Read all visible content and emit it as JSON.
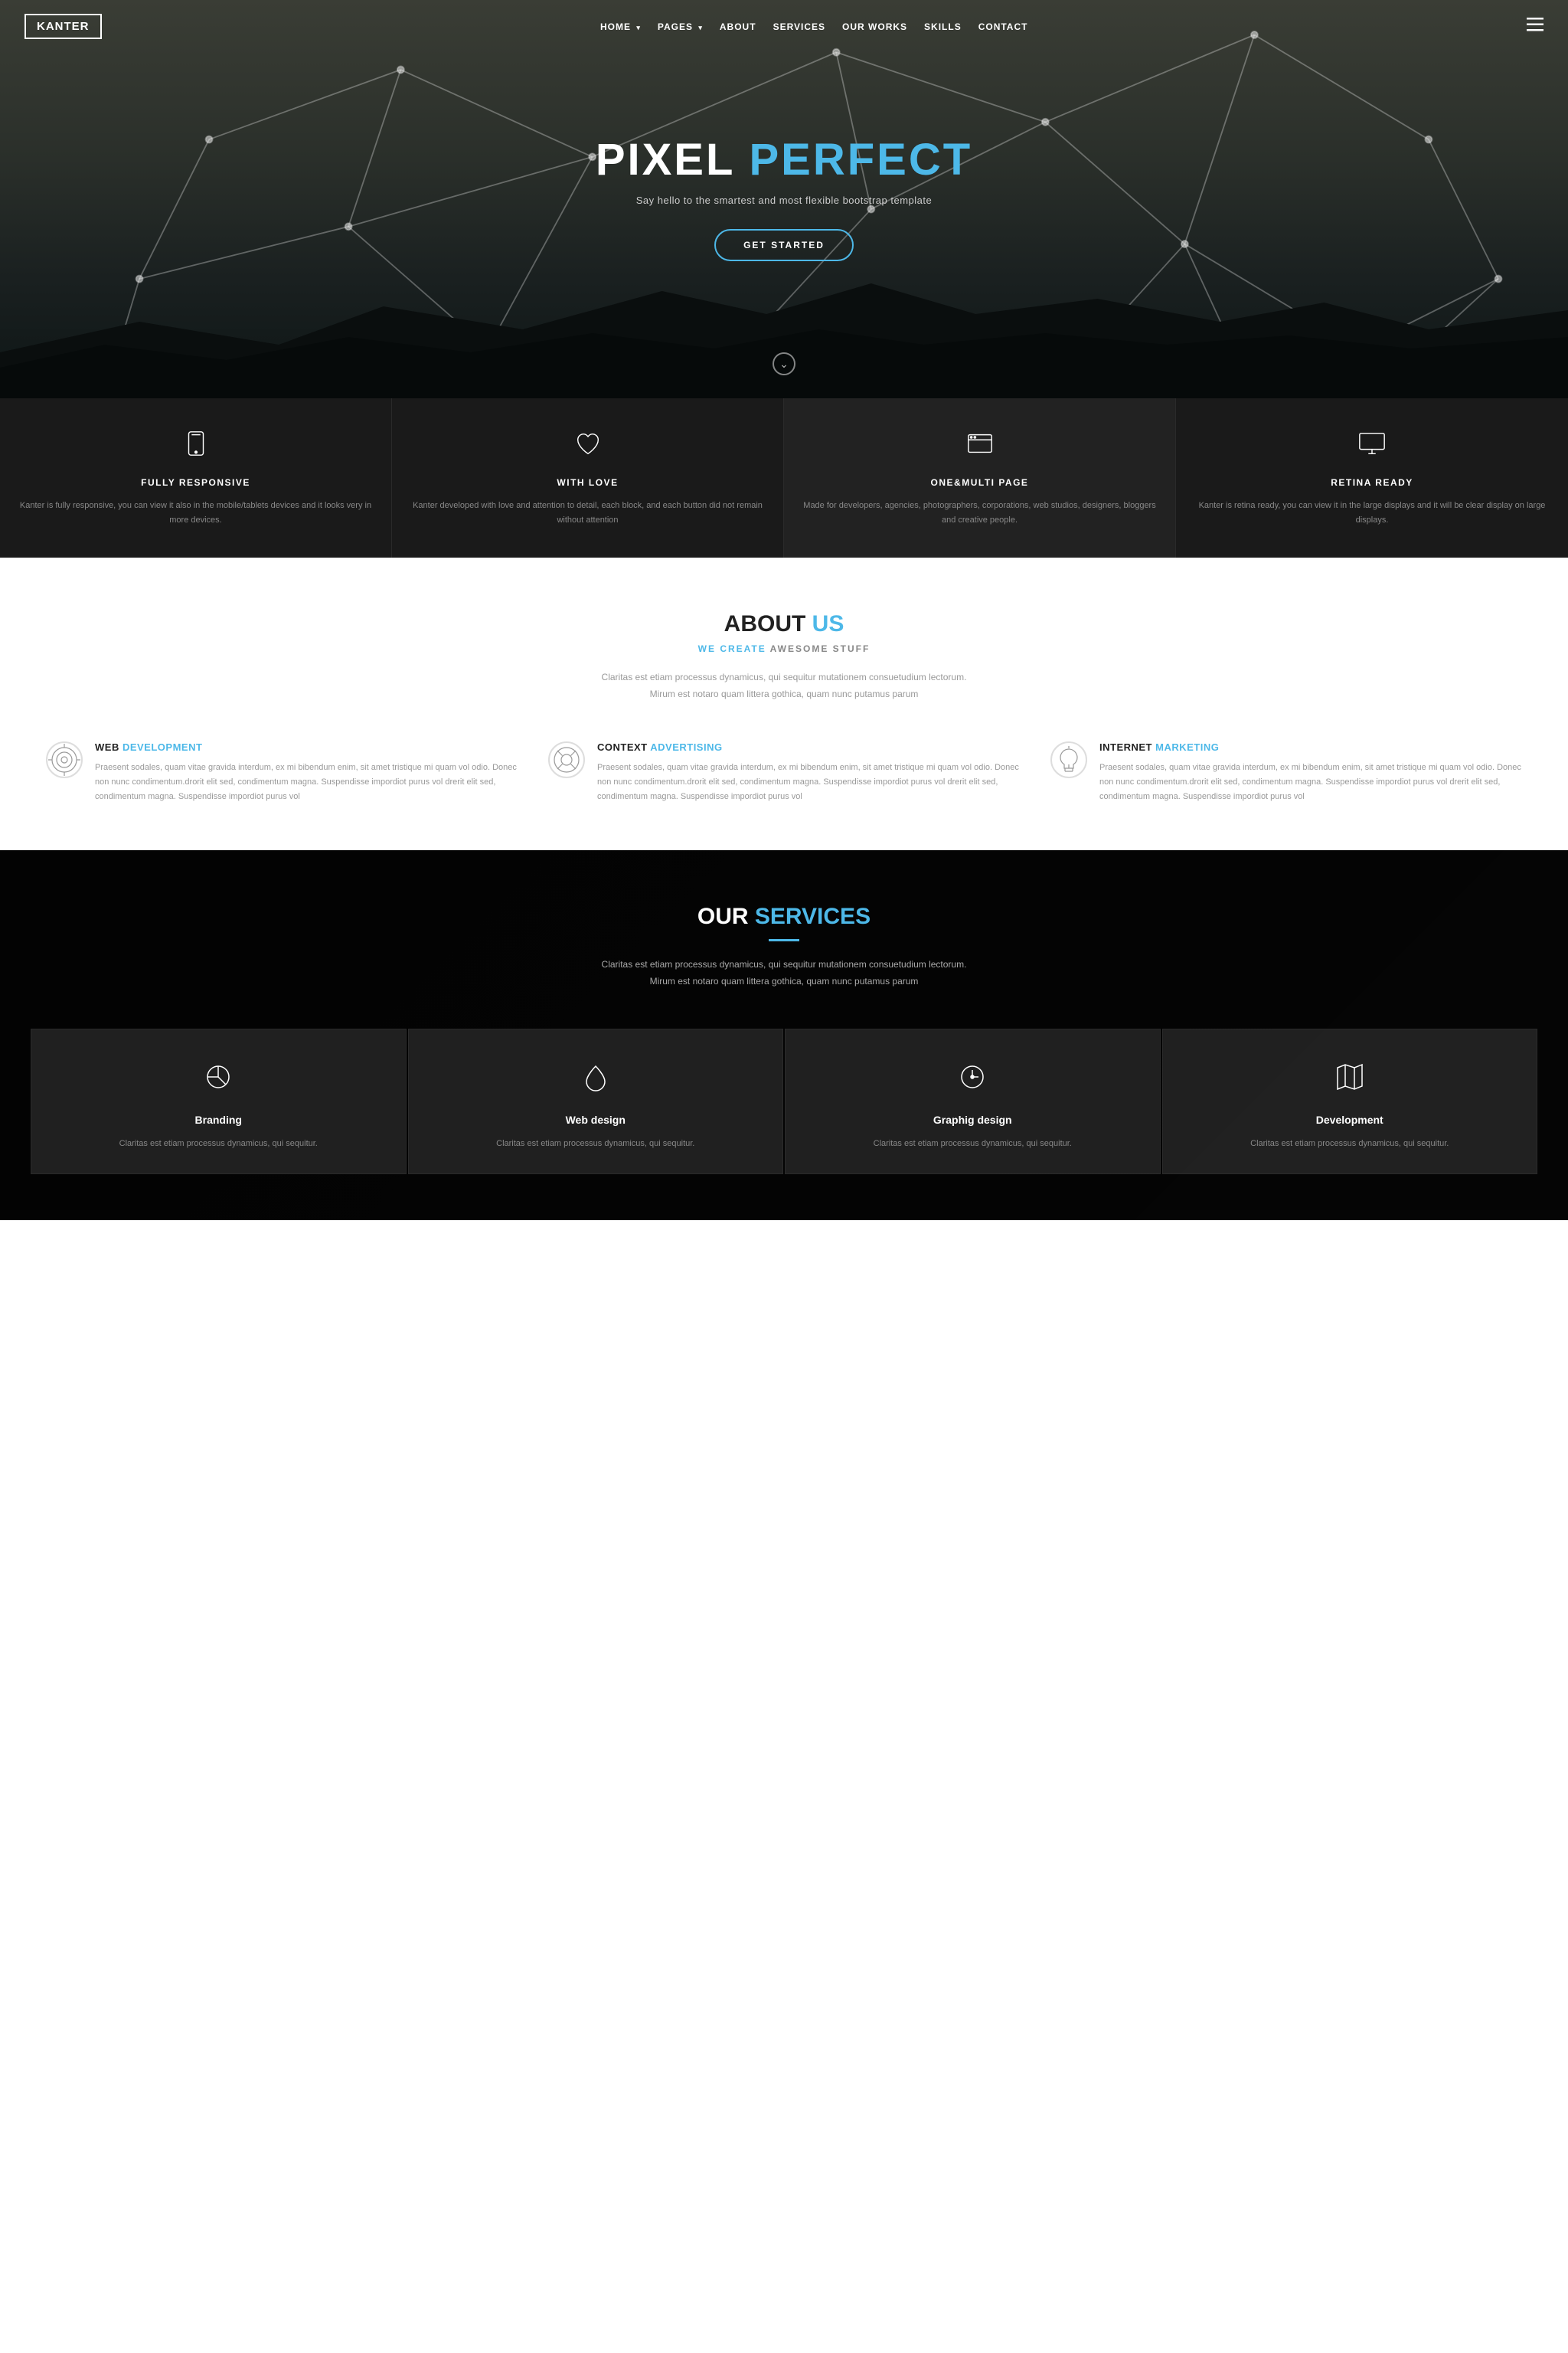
{
  "navbar": {
    "logo": "KANTER",
    "links": [
      {
        "label": "HOME",
        "has_arrow": true,
        "active": false
      },
      {
        "label": "PAGES",
        "has_arrow": true,
        "active": false
      },
      {
        "label": "ABOUT",
        "has_arrow": false,
        "active": false
      },
      {
        "label": "SERVICES",
        "has_arrow": false,
        "active": false
      },
      {
        "label": "OUR WORKS",
        "has_arrow": false,
        "active": false
      },
      {
        "label": "SKILLS",
        "has_arrow": false,
        "active": false
      },
      {
        "label": "CONTACT",
        "has_arrow": false,
        "active": false
      }
    ]
  },
  "hero": {
    "title_part1": "PIXEL ",
    "title_part2": "PERFECT",
    "subtitle": "Say hello to the smartest and most flexible bootstrap template",
    "cta_label": "GET STARTED",
    "scroll_icon": "⌄"
  },
  "features": [
    {
      "title": "FULLY RESPONSIVE",
      "desc": "Kanter is fully responsive, you can view it also in the mobile/tablets devices and it looks very in more devices."
    },
    {
      "title": "WITH LOVE",
      "desc": "Kanter developed with love and attention to detail, each block, and each button did not remain without attention"
    },
    {
      "title": "ONE&MULTI PAGE",
      "desc": "Made for developers, agencies, photographers, corporations, web studios, designers, bloggers and creative people."
    },
    {
      "title": "RETINA READY",
      "desc": "Kanter is retina ready, you can view it in the large displays and it will be clear display on large displays."
    }
  ],
  "about": {
    "title_part1": "ABOUT ",
    "title_part2": "US",
    "subtitle_part1": "WE CREATE",
    "subtitle_part2": " AWESOME STUFF",
    "desc": "Claritas est etiam processus dynamicus, qui sequitur mutationem consuetudium lectorum. Mirum est notaro quam littera gothica, quam nunc putamus parum",
    "features": [
      {
        "title_part1": "WEB ",
        "title_part2": "DEVELOPMENT",
        "desc": "Praesent sodales, quam vitae gravida interdum, ex mi bibendum enim, sit amet tristique mi quam vol odio. Donec non nunc condimentum.drorit elit sed, condimentum magna. Suspendisse impordiot purus vol drerit elit sed, condimentum magna. Suspendisse impordiot purus vol"
      },
      {
        "title_part1": "CONTEXT ",
        "title_part2": "ADVERTISING",
        "desc": "Praesent sodales, quam vitae gravida interdum, ex mi bibendum enim, sit amet tristique mi quam vol odio. Donec non nunc condimentum.drorit elit sed, condimentum magna. Suspendisse impordiot purus vol drerit elit sed, condimentum magna. Suspendisse impordiot purus vol"
      },
      {
        "title_part1": "INTERNET ",
        "title_part2": "MARKETING",
        "desc": "Praesent sodales, quam vitae gravida interdum, ex mi bibendum enim, sit amet tristique mi quam vol odio. Donec non nunc condimentum.drorit elit sed, condimentum magna. Suspendisse impordiot purus vol drerit elit sed, condimentum magna. Suspendisse impordiot purus vol"
      }
    ]
  },
  "services": {
    "title_part1": "OUR ",
    "title_part2": "SERVICES",
    "desc": "Claritas est etiam processus dynamicus, qui sequitur mutationem consuetudium lectorum. Mirum est notaro quam littera gothica, quam nunc putamus parum",
    "items": [
      {
        "title": "Branding",
        "desc": "Claritas est etiam processus dynamicus, qui sequitur."
      },
      {
        "title": "Web design",
        "desc": "Claritas est etiam processus dynamicus, qui sequitur."
      },
      {
        "title": "Graphig design",
        "desc": "Claritas est etiam processus dynamicus, qui sequitur."
      },
      {
        "title": "Development",
        "desc": "Claritas est etiam processus dynamicus, qui sequitur."
      }
    ]
  },
  "colors": {
    "accent": "#4db8e8",
    "dark_bg": "#1a1a1a",
    "darker_bg": "#111"
  }
}
